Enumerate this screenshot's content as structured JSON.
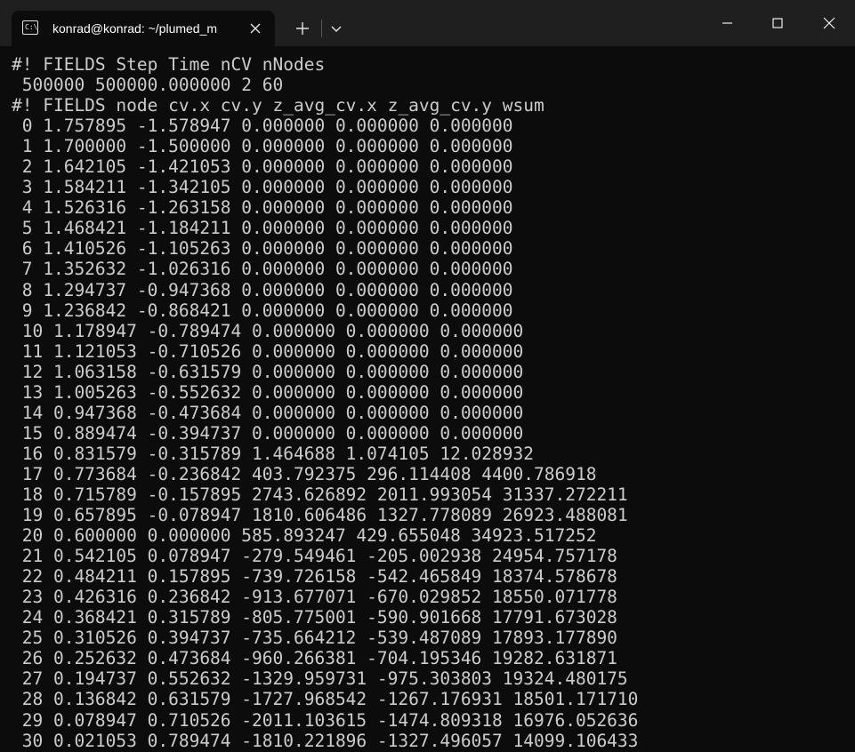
{
  "titlebar": {
    "tab_title": "konrad@konrad: ~/plumed_m",
    "tab_icon": "terminal-icon",
    "icon_glyph": "C:\\",
    "close_icon": "close-icon",
    "new_tab_icon": "plus-icon",
    "dropdown_icon": "chevron-down-icon",
    "window_controls": [
      "minimize-icon",
      "maximize-icon",
      "close-icon"
    ]
  },
  "terminal": {
    "lines": [
      "#! FIELDS Step Time nCV nNodes",
      " 500000 500000.000000 2 60",
      "#! FIELDS node cv.x cv.y z_avg_cv.x z_avg_cv.y wsum",
      " 0 1.757895 -1.578947 0.000000 0.000000 0.000000",
      " 1 1.700000 -1.500000 0.000000 0.000000 0.000000",
      " 2 1.642105 -1.421053 0.000000 0.000000 0.000000",
      " 3 1.584211 -1.342105 0.000000 0.000000 0.000000",
      " 4 1.526316 -1.263158 0.000000 0.000000 0.000000",
      " 5 1.468421 -1.184211 0.000000 0.000000 0.000000",
      " 6 1.410526 -1.105263 0.000000 0.000000 0.000000",
      " 7 1.352632 -1.026316 0.000000 0.000000 0.000000",
      " 8 1.294737 -0.947368 0.000000 0.000000 0.000000",
      " 9 1.236842 -0.868421 0.000000 0.000000 0.000000",
      " 10 1.178947 -0.789474 0.000000 0.000000 0.000000",
      " 11 1.121053 -0.710526 0.000000 0.000000 0.000000",
      " 12 1.063158 -0.631579 0.000000 0.000000 0.000000",
      " 13 1.005263 -0.552632 0.000000 0.000000 0.000000",
      " 14 0.947368 -0.473684 0.000000 0.000000 0.000000",
      " 15 0.889474 -0.394737 0.000000 0.000000 0.000000",
      " 16 0.831579 -0.315789 1.464688 1.074105 12.028932",
      " 17 0.773684 -0.236842 403.792375 296.114408 4400.786918",
      " 18 0.715789 -0.157895 2743.626892 2011.993054 31337.272211",
      " 19 0.657895 -0.078947 1810.606486 1327.778089 26923.488081",
      " 20 0.600000 0.000000 585.893247 429.655048 34923.517252",
      " 21 0.542105 0.078947 -279.549461 -205.002938 24954.757178",
      " 22 0.484211 0.157895 -739.726158 -542.465849 18374.578678",
      " 23 0.426316 0.236842 -913.677071 -670.029852 18550.071778",
      " 24 0.368421 0.315789 -805.775001 -590.901668 17791.673028",
      " 25 0.310526 0.394737 -735.664212 -539.487089 17893.177890",
      " 26 0.252632 0.473684 -960.266381 -704.195346 19282.631871",
      " 27 0.194737 0.552632 -1329.959731 -975.303803 19324.480175",
      " 28 0.136842 0.631579 -1727.968542 -1267.176931 18501.171710",
      " 29 0.078947 0.710526 -2011.103615 -1474.809318 16976.052636",
      " 30 0.021053 0.789474 -1810.221896 -1327.496057 14099.106433"
    ]
  },
  "colors": {
    "titlebar_bg": "#1f1f1f",
    "tab_bg": "#0c0c0c",
    "terminal_bg": "#0c0c0c",
    "terminal_fg": "#cccccc",
    "title_fg": "#ffffff"
  }
}
